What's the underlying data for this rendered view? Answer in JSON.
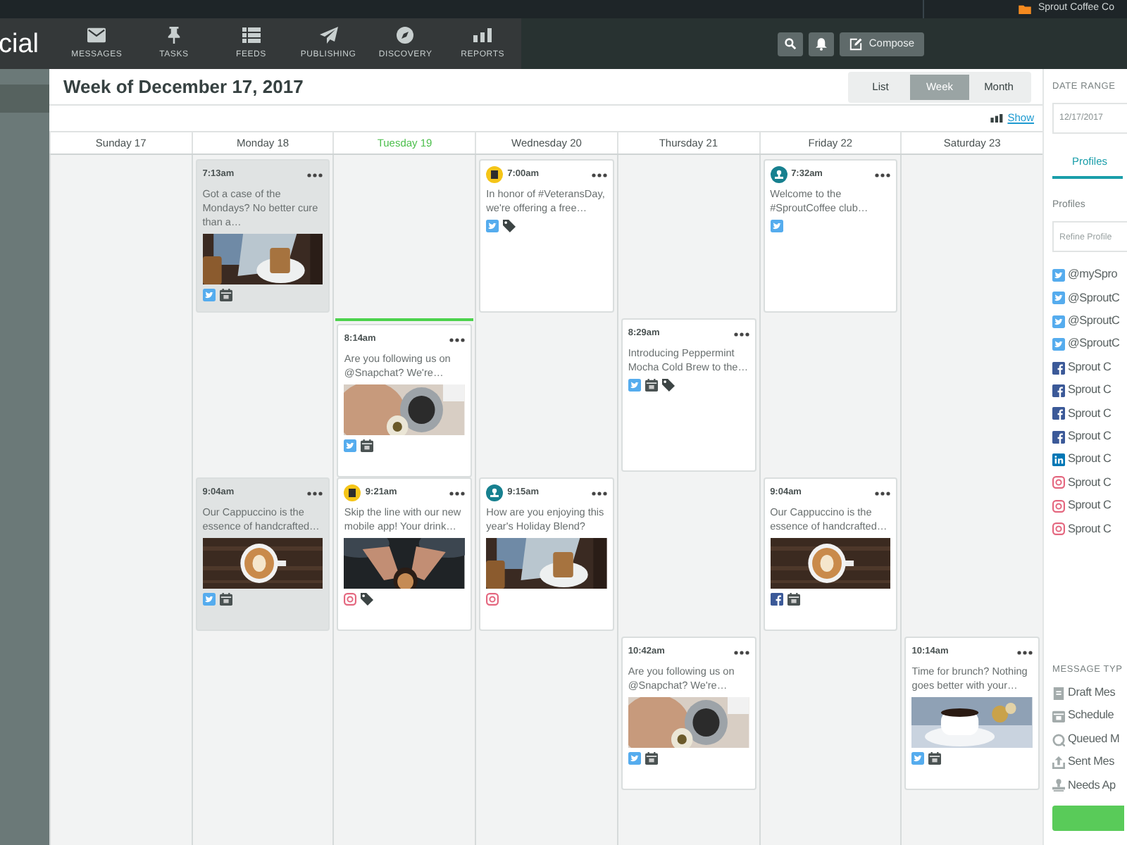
{
  "account": {
    "name": "Sprout Coffee Co"
  },
  "nav": {
    "logo": "cial",
    "items": [
      {
        "label": "MESSAGES"
      },
      {
        "label": "TASKS"
      },
      {
        "label": "FEEDS"
      },
      {
        "label": "PUBLISHING"
      },
      {
        "label": "DISCOVERY"
      },
      {
        "label": "REPORTS"
      }
    ],
    "compose": "Compose"
  },
  "calendar": {
    "title": "Week of December 17, 2017",
    "views": [
      {
        "label": "List",
        "selected": false
      },
      {
        "label": "Week",
        "selected": true
      },
      {
        "label": "Month",
        "selected": false
      }
    ],
    "show_link": "Show",
    "days": [
      {
        "label": "Sunday 17",
        "today": false
      },
      {
        "label": "Monday 18",
        "today": false,
        "slots": [
          {
            "kind": "post",
            "time": "7:13am",
            "text": "Got a case of the Mondays? No better cure than a…",
            "media": {
              "kind": "picture"
            },
            "icons": [
              {
                "kind": "twitter"
              },
              {
                "kind": "calendar"
              }
            ],
            "past": true
          },
          {
            "kind": "empty"
          },
          {
            "kind": "post",
            "time": "9:04am",
            "text": "Our Cappuccino is the essence of handcrafted…",
            "media": {
              "kind": "picture"
            },
            "icons": [
              {
                "kind": "twitter"
              },
              {
                "kind": "calendar"
              }
            ],
            "past": true
          }
        ]
      },
      {
        "label": "Tuesday 19",
        "today": true,
        "slots": [
          {
            "kind": "empty"
          },
          {
            "kind": "post",
            "time": "8:14am",
            "text": "Are you following us on @Snapchat? We're…",
            "media": {
              "kind": "picture"
            },
            "icons": [
              {
                "kind": "twitter"
              },
              {
                "kind": "calendar"
              }
            ],
            "past": false,
            "now_marker": true
          },
          {
            "kind": "post",
            "badge": {
              "kind": "device"
            },
            "time": "9:21am",
            "text": "Skip the line with our new mobile app! Your drink…",
            "media": {
              "kind": "picture"
            },
            "icons": [
              {
                "kind": "instagram"
              },
              {
                "kind": "tag"
              }
            ],
            "past": false
          }
        ]
      },
      {
        "label": "Wednesday 20",
        "today": false,
        "slots": [
          {
            "kind": "post",
            "badge": {
              "kind": "device"
            },
            "time": "7:00am",
            "text": "In honor of #VeteransDay, we're offering a free…",
            "icons": [
              {
                "kind": "twitter"
              },
              {
                "kind": "tag"
              }
            ],
            "past": false
          },
          {
            "kind": "empty"
          },
          {
            "kind": "post",
            "badge": {
              "kind": "person"
            },
            "time": "9:15am",
            "text": "How are you enjoying this year's Holiday Blend?",
            "media": {
              "kind": "picture"
            },
            "icons": [
              {
                "kind": "instagram"
              }
            ],
            "past": false
          }
        ]
      },
      {
        "label": "Thursday 21",
        "today": false,
        "slots": [
          {
            "kind": "empty"
          },
          {
            "kind": "post",
            "time": "8:29am",
            "text": "Introducing Peppermint Mocha Cold Brew to the…",
            "icons": [
              {
                "kind": "twitter"
              },
              {
                "kind": "calendar"
              },
              {
                "kind": "tag"
              }
            ],
            "past": false
          },
          {
            "kind": "empty"
          },
          {
            "kind": "post",
            "time": "10:42am",
            "text": "Are you following us on @Snapchat? We're…",
            "media": {
              "kind": "picture"
            },
            "icons": [
              {
                "kind": "twitter"
              },
              {
                "kind": "calendar"
              }
            ],
            "past": false
          }
        ]
      },
      {
        "label": "Friday 22",
        "today": false,
        "slots": [
          {
            "kind": "post",
            "badge": {
              "kind": "person"
            },
            "time": "7:32am",
            "text": "Welcome to the #SproutCoffee club…",
            "icons": [
              {
                "kind": "twitter"
              }
            ],
            "past": false
          },
          {
            "kind": "empty"
          },
          {
            "kind": "post",
            "time": "9:04am",
            "text": "Our Cappuccino is the essence of handcrafted…",
            "media": {
              "kind": "picture"
            },
            "icons": [
              {
                "kind": "facebook"
              },
              {
                "kind": "calendar"
              }
            ],
            "past": false
          }
        ]
      },
      {
        "label": "Saturday 23",
        "today": false,
        "slots": [
          {
            "kind": "empty"
          },
          {
            "kind": "empty"
          },
          {
            "kind": "empty"
          },
          {
            "kind": "post",
            "time": "10:14am",
            "text": "Time for brunch? Nothing goes better with your…",
            "media": {
              "kind": "picture"
            },
            "icons": [
              {
                "kind": "twitter"
              },
              {
                "kind": "calendar"
              }
            ],
            "past": false
          }
        ]
      }
    ]
  },
  "panel": {
    "date_range_label": "DATE RANGE",
    "date_value": "12/17/2017",
    "tabs": [
      {
        "label": "Profiles",
        "selected": true
      }
    ],
    "profiles_label": "Profiles",
    "refine_placeholder": "Refine Profile",
    "profiles": [
      {
        "kind": "twitter",
        "name": "@mySpro"
      },
      {
        "kind": "twitter",
        "name": "@SproutC"
      },
      {
        "kind": "twitter",
        "name": "@SproutC"
      },
      {
        "kind": "twitter",
        "name": "@SproutC"
      },
      {
        "kind": "facebook",
        "name": "Sprout C"
      },
      {
        "kind": "facebook",
        "name": "Sprout C"
      },
      {
        "kind": "facebook",
        "name": "Sprout C"
      },
      {
        "kind": "facebook",
        "name": "Sprout C"
      },
      {
        "kind": "linkedin",
        "name": "Sprout C"
      },
      {
        "kind": "instagram",
        "name": "Sprout C"
      },
      {
        "kind": "instagram",
        "name": "Sprout C"
      },
      {
        "kind": "instagram",
        "name": "Sprout C"
      }
    ],
    "message_types_label": "MESSAGE TYP",
    "message_types": [
      {
        "label": "Draft Mes"
      },
      {
        "label": "Schedule"
      },
      {
        "label": "Queued M"
      },
      {
        "label": "Sent Mes"
      },
      {
        "label": "Needs Ap"
      }
    ]
  }
}
